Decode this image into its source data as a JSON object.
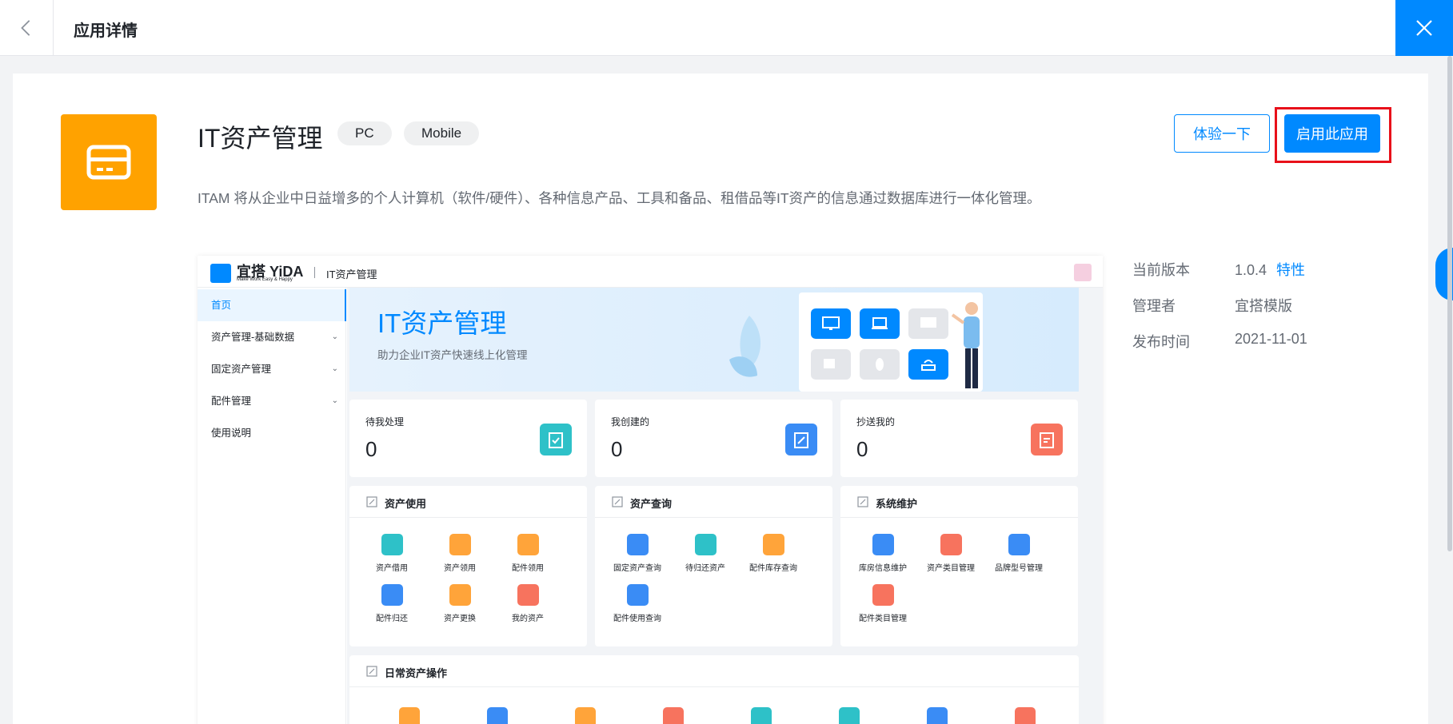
{
  "header": {
    "back_icon": "chevron-left-icon",
    "title": "应用详情",
    "close_icon": "close-icon"
  },
  "app": {
    "name": "IT资产管理",
    "icon": "card-icon",
    "icon_color": "#ffa200",
    "tags": [
      "PC",
      "Mobile"
    ],
    "description": "ITAM 将从企业中日益增多的个人计算机（软件/硬件）、各种信息产品、工具和备品、租借品等IT资产的信息通过数据库进行一体化管理。"
  },
  "actions": {
    "try_label": "体验一下",
    "enable_label": "启用此应用",
    "accent": "#0089ff",
    "highlight_color": "#e8101a"
  },
  "meta": {
    "version_label": "当前版本",
    "version_value": "1.0.4",
    "features_link": "特性",
    "admin_label": "管理者",
    "admin_value": "宜搭模版",
    "publish_label": "发布时间",
    "publish_value": "2021-11-01"
  },
  "preview": {
    "brand": "宜搭 YiDA",
    "brand_tagline": "Make Work Easy & Happy",
    "app_name": "IT资产管理",
    "nav": [
      {
        "label": "首页"
      },
      {
        "label": "资产管理-基础数据"
      },
      {
        "label": "固定资产管理"
      },
      {
        "label": "配件管理"
      },
      {
        "label": "使用说明"
      }
    ],
    "banner_title": "IT资产管理",
    "banner_subtitle": "助力企业IT资产快速线上化管理",
    "stats": [
      {
        "label": "待我处理",
        "value": "0",
        "color": "#2ec1c8"
      },
      {
        "label": "我创建的",
        "value": "0",
        "color": "#3a8cf5"
      },
      {
        "label": "抄送我的",
        "value": "0",
        "color": "#f7735e"
      }
    ],
    "panels": [
      {
        "title": "资产使用",
        "items": [
          {
            "label": "资产借用",
            "color": "#2ec1c8"
          },
          {
            "label": "资产领用",
            "color": "#ffa43a"
          },
          {
            "label": "配件领用",
            "color": "#ffa43a"
          },
          {
            "label": "配件归还",
            "color": "#3a8cf5"
          },
          {
            "label": "资产更换",
            "color": "#ffa43a"
          },
          {
            "label": "我的资产",
            "color": "#f7735e"
          }
        ]
      },
      {
        "title": "资产查询",
        "items": [
          {
            "label": "固定资产查询",
            "color": "#3a8cf5"
          },
          {
            "label": "待归还资产",
            "color": "#2ec1c8"
          },
          {
            "label": "配件库存查询",
            "color": "#ffa43a"
          },
          {
            "label": "配件使用查询",
            "color": "#3a8cf5"
          }
        ]
      },
      {
        "title": "系统维护",
        "items": [
          {
            "label": "库房信息维护",
            "color": "#3a8cf5"
          },
          {
            "label": "资产类目管理",
            "color": "#f7735e"
          },
          {
            "label": "品牌型号管理",
            "color": "#3a8cf5"
          },
          {
            "label": "配件类目管理",
            "color": "#f7735e"
          }
        ]
      }
    ],
    "daily_title": "日常资产操作",
    "daily_icon_colors": [
      "#ffa43a",
      "#3a8cf5",
      "#ffa43a",
      "#f7735e",
      "#2ec1c8",
      "#2ec1c8",
      "#3a8cf5",
      "#f7735e"
    ]
  }
}
